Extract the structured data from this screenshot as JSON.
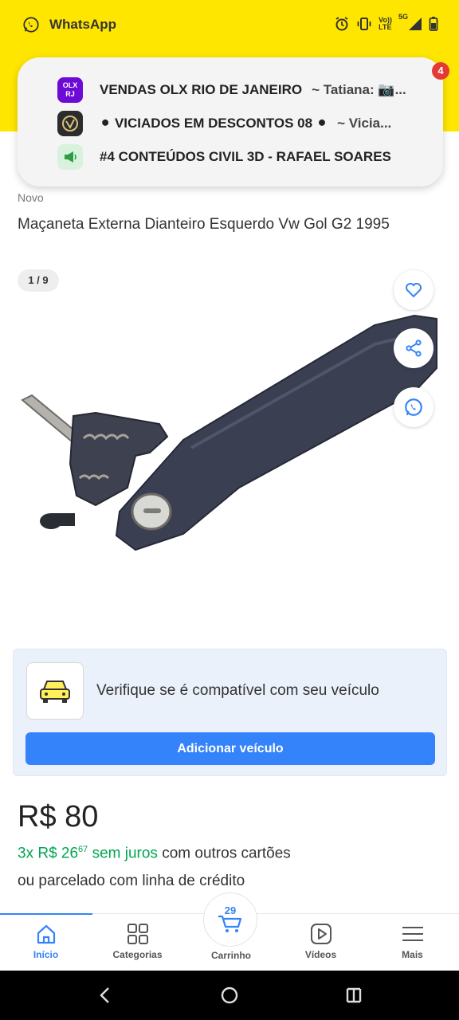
{
  "status_bar": {
    "app_name": "WhatsApp",
    "network_top": "Vo))",
    "network_bottom": "LTE",
    "signal_label": "5G"
  },
  "notification": {
    "badge": "4",
    "rows": [
      {
        "icon": "olx-rj-group-icon",
        "icon_text": "OLX RJ",
        "title": "VENDAS OLX RIO DE JANEIRO",
        "snippet": "~ Tatiana: 📷..."
      },
      {
        "icon": "viciados-group-icon",
        "icon_text": "",
        "title": "⚫ VICIADOS EM DESCONTOS 08 ⚫",
        "snippet": "~ Vicia..."
      },
      {
        "icon": "megaphone-icon",
        "icon_text": "",
        "title": "#4 CONTEÚDOS CIVIL 3D - RAFAEL SOARES",
        "snippet": ""
      }
    ]
  },
  "product": {
    "condition": "Novo",
    "title": "Maçaneta Externa Dianteiro Esquerdo Vw Gol G2 1995",
    "image_counter": "1 / 9"
  },
  "compat": {
    "text": "Verifique se é compatível com seu veículo",
    "button": "Adicionar veículo"
  },
  "price": {
    "main": "R$ 80",
    "installment_prefix": "3x R$ 26",
    "installment_cents": "67",
    "installment_green_suffix": " sem juros",
    "installment_rest": " com outros cartões",
    "credit_line": "ou parcelado com linha de crédito"
  },
  "bottom_nav": {
    "items": [
      {
        "label": "Início",
        "active": true
      },
      {
        "label": "Categorias",
        "active": false
      },
      {
        "label": "Carrinho",
        "active": false,
        "count": "29"
      },
      {
        "label": "Vídeos",
        "active": false
      },
      {
        "label": "Mais",
        "active": false
      }
    ]
  },
  "colors": {
    "header_yellow": "#ffe600",
    "primary_blue": "#3483fa",
    "green": "#00a650"
  }
}
